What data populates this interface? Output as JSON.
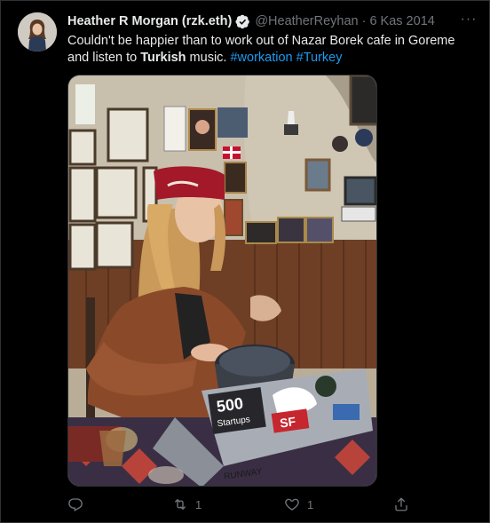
{
  "author": {
    "name": "Heather R Morgan (rzk.eth)",
    "handle": "@HeatherReyhan",
    "separator": "·",
    "date": "6 Kas 2014"
  },
  "more_menu": "···",
  "tweet": {
    "text_part1": "Couldn't be happier than to work out of Nazar Borek cafe in Goreme and listen to ",
    "text_bold": "Turkish",
    "text_part2": " music. ",
    "hashtag1": "#workation",
    "hashtag2": "#Turkey"
  },
  "photo": {
    "sticker_500": "500",
    "sticker_startups": "Startups",
    "sticker_sf": "SF",
    "sticker_runway": "RUNWAY"
  },
  "actions": {
    "reply_count": "",
    "retweet_count": "1",
    "like_count": "1"
  },
  "colors": {
    "background": "#000000",
    "text": "#e7e9ea",
    "muted": "#71767b",
    "link": "#1d9bf0",
    "verified": "#1d9bf0"
  }
}
